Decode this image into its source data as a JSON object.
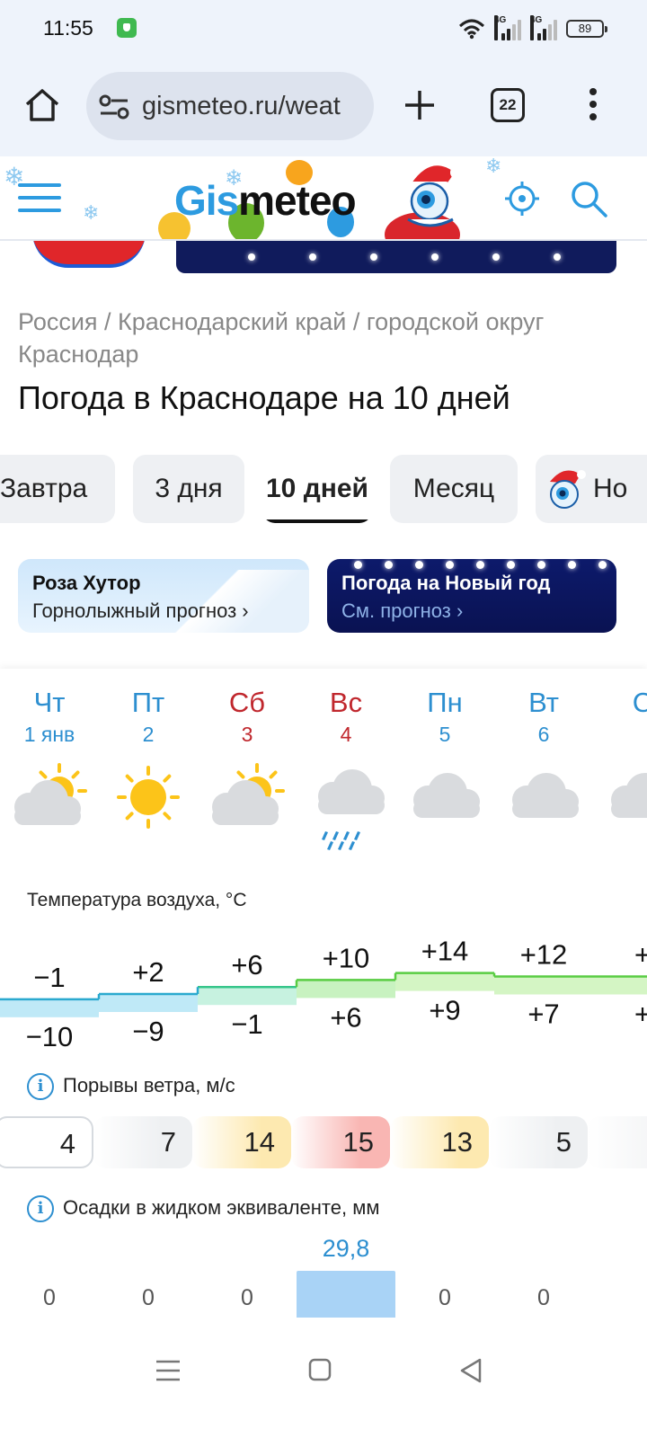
{
  "status_bar": {
    "time": "11:55",
    "battery": "89",
    "network1": "4G",
    "network2": "4G"
  },
  "browser": {
    "url": "gismeteo.ru/weat",
    "tab_count": "22"
  },
  "site": {
    "logo_part1": "Gis",
    "logo_part2": "meteo"
  },
  "breadcrumb": "Россия / Краснодарский край / городской округ Краснодар",
  "page_title": "Погода в Краснодаре на 10 дней",
  "period_tabs": [
    {
      "label": "Завтра",
      "active": false
    },
    {
      "label": "3 дня",
      "active": false
    },
    {
      "label": "10 дней",
      "active": true
    },
    {
      "label": "Месяц",
      "active": false
    },
    {
      "label": "Но",
      "active": false
    }
  ],
  "banners": {
    "roza": {
      "title": "Роза Хутор",
      "subtitle": "Горнолыжный прогноз ›"
    },
    "newyear": {
      "title": "Погода на Новый год",
      "subtitle": "См. прогноз ›"
    }
  },
  "days": [
    {
      "dow": "Чт",
      "date": "1 янв",
      "weekend": false,
      "icon": "partly-cloudy-icon"
    },
    {
      "dow": "Пт",
      "date": "2",
      "weekend": false,
      "icon": "sunny-icon"
    },
    {
      "dow": "Сб",
      "date": "3",
      "weekend": true,
      "icon": "partly-cloudy-icon"
    },
    {
      "dow": "Вс",
      "date": "4",
      "weekend": true,
      "icon": "rain-icon"
    },
    {
      "dow": "Пн",
      "date": "5",
      "weekend": false,
      "icon": "cloudy-icon"
    },
    {
      "dow": "Вт",
      "date": "6",
      "weekend": false,
      "icon": "cloudy-icon"
    },
    {
      "dow": "С",
      "date": "",
      "weekend": false,
      "icon": "cloudy-icon"
    }
  ],
  "temperature": {
    "label": "Температура воздуха, °C",
    "max": [
      "−1",
      "+2",
      "+6",
      "+10",
      "+14",
      "+12",
      "+"
    ],
    "min": [
      "−10",
      "−9",
      "−1",
      "+6",
      "+9",
      "+7",
      "+"
    ],
    "max_values": [
      -1,
      2,
      6,
      10,
      14,
      12,
      12
    ],
    "band_colors": [
      "#bfe9f7",
      "#bfe9f7",
      "#c7f2e0",
      "#c8f2c0",
      "#d4f5c4",
      "#d4f5c4",
      "#d4f5c4"
    ]
  },
  "wind": {
    "label": "Порывы ветра, м/с",
    "values": [
      "4",
      "7",
      "14",
      "15",
      "13",
      "5",
      ""
    ],
    "colors": [
      "#ffffff",
      "#eef0f2",
      "#fde9b0",
      "#f9b6b3",
      "#fde9b0",
      "#eef0f2",
      "#f4f5f6"
    ]
  },
  "precip": {
    "label": "Осадки в жидком эквиваленте, мм",
    "values": [
      "0",
      "0",
      "0",
      "29,8",
      "0",
      "0",
      ""
    ],
    "amounts": [
      0,
      0,
      0,
      29.8,
      0,
      0,
      0
    ]
  }
}
